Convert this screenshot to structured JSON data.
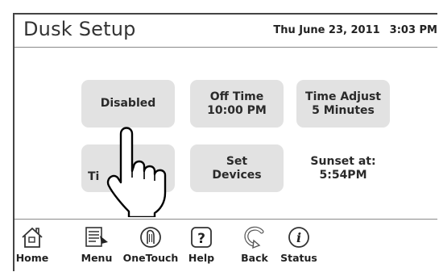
{
  "header": {
    "title": "Dusk Setup",
    "date": "Thu June 23, 2011",
    "time": "3:03 PM"
  },
  "buttons": {
    "disabled": {
      "label": "Disabled"
    },
    "off_time": {
      "line1": "Off Time",
      "line2": "10:00 PM"
    },
    "time_adjust": {
      "line1": "Time Adjust",
      "line2": "5 Minutes"
    },
    "timer": {
      "visible_text": "Ti"
    },
    "set_devices": {
      "line1": "Set",
      "line2": "Devices"
    }
  },
  "sunset": {
    "line1": "Sunset at:",
    "line2": "5:54PM"
  },
  "toolbar": {
    "items": [
      {
        "label": "Home",
        "icon": "home-icon"
      },
      {
        "label": "Menu",
        "icon": "menu-icon"
      },
      {
        "label": "OneTouch",
        "icon": "onetouch-icon"
      },
      {
        "label": "Help",
        "icon": "help-icon"
      },
      {
        "label": "Back",
        "icon": "back-icon"
      },
      {
        "label": "Status",
        "icon": "status-icon"
      }
    ]
  },
  "colors": {
    "button_bg": "#e2e2e2",
    "border": "#444444",
    "text": "#2a2a2a"
  }
}
